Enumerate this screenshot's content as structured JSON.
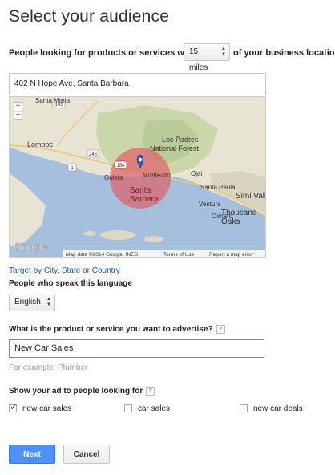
{
  "page": {
    "title": "Select your audience",
    "radius_prefix": "People looking for products or services within",
    "radius_value": "15 miles",
    "radius_suffix": "of your business location",
    "address_value": "402 N Hope Ave, Santa Barbara"
  },
  "map": {
    "zoom_in": "+",
    "zoom_out": "−",
    "places": {
      "santa_maria": "Santa Maria",
      "lompoc": "Lompoc",
      "los_padres": "Los Padres",
      "national_forest": "National Forest",
      "montecito": "Montecito",
      "goleta": "Goleta",
      "santa": "Santa",
      "barbara": "Barbara",
      "ojai": "Ojai",
      "santa_paula": "Santa Paula",
      "simi_valley": "Simi Valle",
      "ventura": "Ventura",
      "thousand": "Thousand",
      "oaks": "Oaks",
      "oxnard": "Oxnard"
    },
    "shields": {
      "r101": "101",
      "r246": "246",
      "r1": "1",
      "r154": "154"
    },
    "logo": "Google",
    "attribution": "Map data ©2014 Google, INEGI",
    "terms": "Terms of Use",
    "report": "Report a map error"
  },
  "location": {
    "target_link": "Target by City, State or Country"
  },
  "language": {
    "label": "People who speak this language",
    "selected": "English"
  },
  "product": {
    "label": "What is the product or service you want to advertise?",
    "help": "?",
    "value": "New Car Sales",
    "example": "For example: Plumber"
  },
  "keywords": {
    "label": "Show your ad to people looking for",
    "help": "?",
    "items": [
      {
        "label": "new car sales",
        "checked": true
      },
      {
        "label": "car sales",
        "checked": false
      },
      {
        "label": "new car deals",
        "checked": false
      }
    ]
  },
  "actions": {
    "next": "Next",
    "cancel": "Cancel"
  },
  "colors": {
    "primary": "#4d90fe",
    "link": "#1155cc",
    "radius_circle": "#e0606a",
    "water": "#a5bfdd"
  }
}
